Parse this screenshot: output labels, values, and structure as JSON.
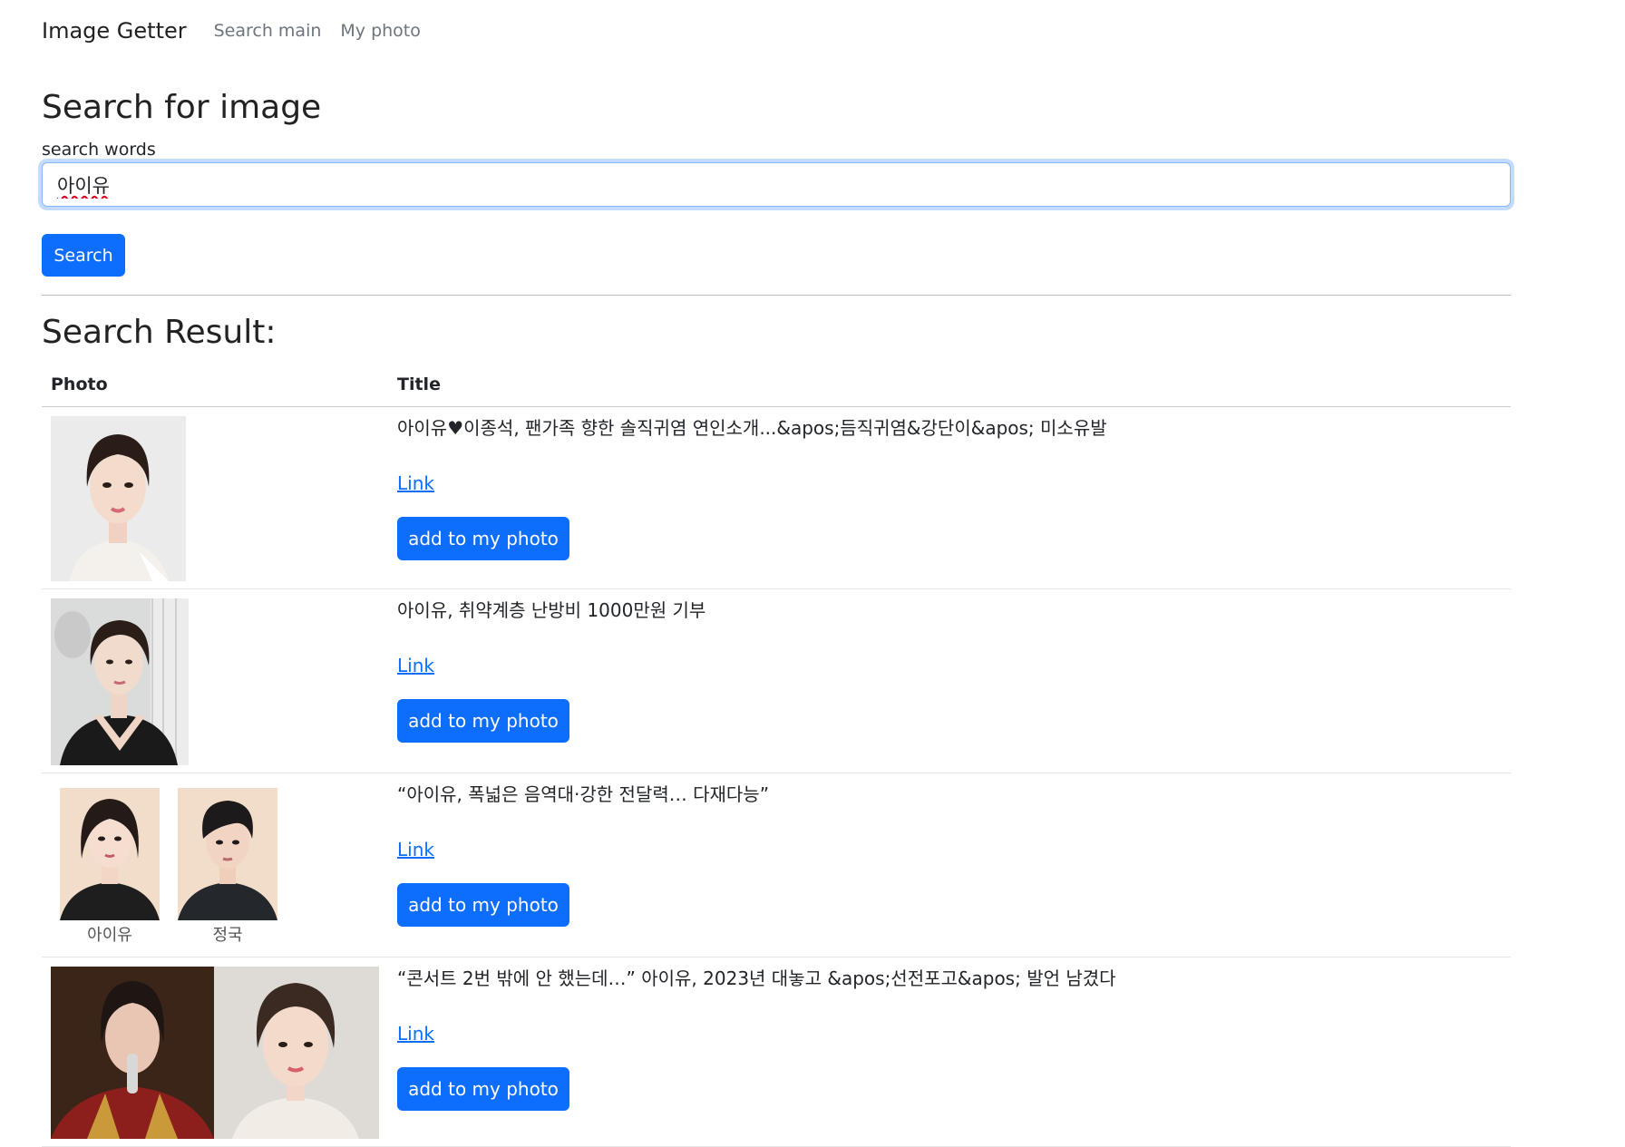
{
  "nav": {
    "brand": "Image Getter",
    "links": [
      "Search main",
      "My photo"
    ]
  },
  "search": {
    "heading": "Search for image",
    "label": "search words",
    "value": "아이유",
    "button": "Search"
  },
  "results": {
    "heading": "Search Result:",
    "columns": [
      "Photo",
      "Title"
    ],
    "link_label": "Link",
    "add_label": "add to my photo",
    "rows": [
      {
        "title": "아이유♥이종석, 팬가족 향한 솔직귀염 연인소개...&apos;듬직귀염&강단이&apos; 미소유발"
      },
      {
        "title": "아이유, 취약계층 난방비 1000만원 기부"
      },
      {
        "title": "“아이유, 폭넓은 음역대·강한 전달력… 다재다능”",
        "caption_left": "아이유",
        "caption_right": "정국"
      },
      {
        "title": "“콘서트 2번 밖에 안 했는데…” 아이유, 2023년 대놓고 &apos;선전포고&apos; 발언 남겼다"
      }
    ]
  },
  "colors": {
    "primary": "#0d6efd",
    "focus_border": "#86b7fe",
    "muted": "#6c757d"
  }
}
